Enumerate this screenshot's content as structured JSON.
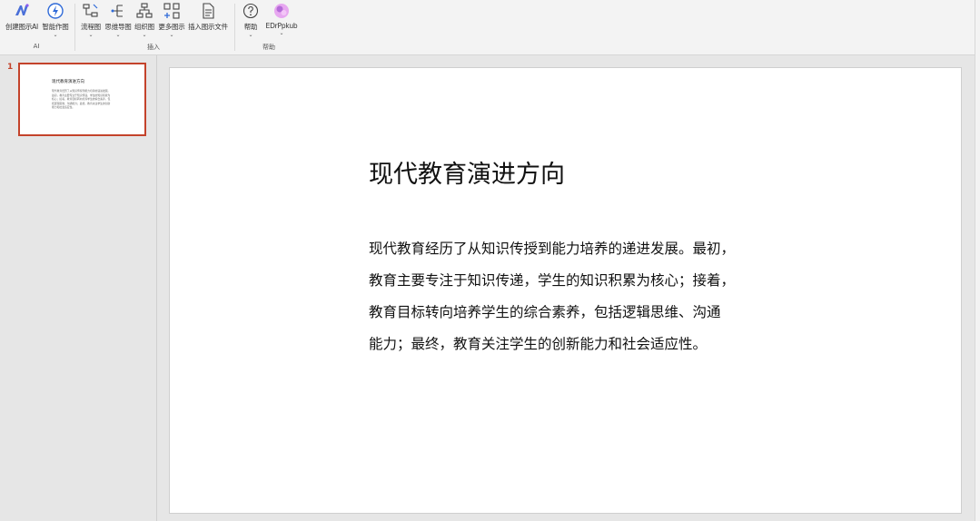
{
  "ribbon": {
    "buttons": [
      {
        "id": "ai-create",
        "label": "创建图示AI",
        "icon": "ai-sparkle-icon"
      },
      {
        "id": "smart-draw",
        "label": "智能作图",
        "icon": "lightning-icon"
      },
      {
        "id": "flowchart",
        "label": "流程图",
        "icon": "flowchart-icon"
      },
      {
        "id": "mindmap",
        "label": "思维导图",
        "icon": "mindmap-icon"
      },
      {
        "id": "org",
        "label": "组织图",
        "icon": "org-chart-icon"
      },
      {
        "id": "more",
        "label": "更多图示",
        "icon": "more-shapes-icon"
      },
      {
        "id": "insert-file",
        "label": "插入图示文件",
        "icon": "document-icon"
      },
      {
        "id": "help",
        "label": "帮助",
        "icon": "help-icon"
      },
      {
        "id": "edraw",
        "label": "EDrPpkub",
        "icon": "edraw-logo-icon"
      }
    ],
    "groups": {
      "ai": "AI",
      "insert": "插入",
      "help": "帮助"
    }
  },
  "thumbnails": [
    {
      "number": "1",
      "title": "现代教育演进方向",
      "body": "现代教育经历了从知识传授到能力培养的递进发展。最初，教育主要专注于知识传递，学生的知识积累为核心；接着，教育目标转向培养学生的综合素养，包括逻辑思维、沟通能力；最终，教育关注学生的创新能力和社会适应性。"
    }
  ],
  "slide": {
    "title": "现代教育演进方向",
    "body_lines": [
      "现代教育经历了从知识传授到能力培养的递进发展。最初，",
      "教育主要专注于知识传递，学生的知识积累为核心；接着，",
      "教育目标转向培养学生的综合素养，包括逻辑思维、沟通",
      "能力；最终，教育关注学生的创新能力和社会适应性。"
    ]
  },
  "colors": {
    "accent": "#c4432b",
    "ribbon_bg": "#f3f3f3",
    "workspace_bg": "#e6e6e6"
  }
}
